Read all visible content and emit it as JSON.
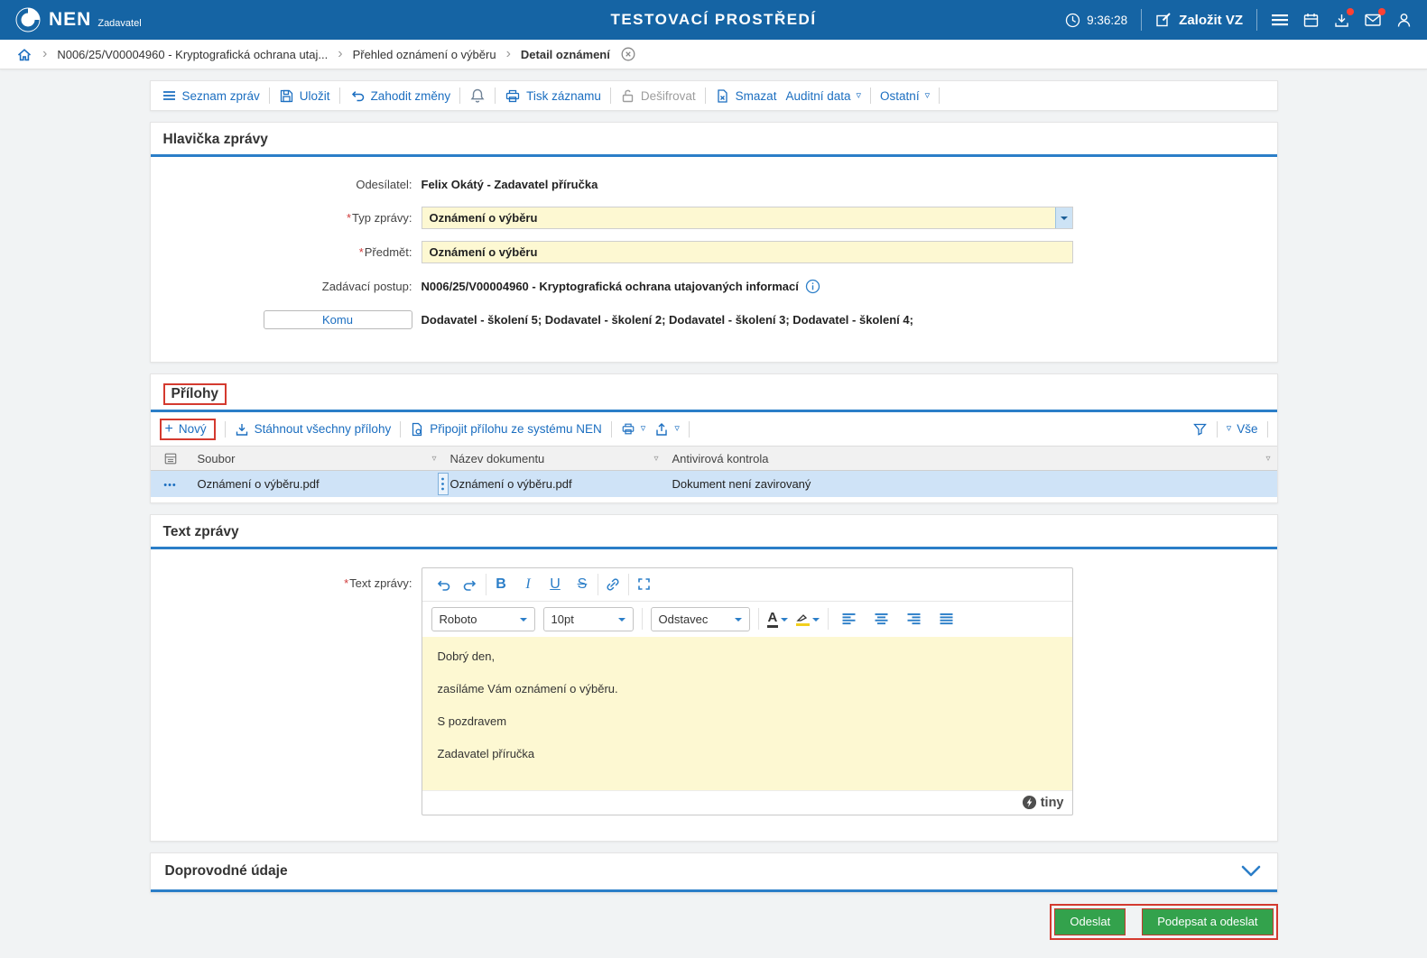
{
  "colors": {
    "topbar_blue": "#1564a4",
    "link_blue": "#1b6ec0",
    "section_line_blue": "#2b7ec8",
    "field_yellow": "#fdf8d2",
    "selected_row_blue": "#cfe3f7",
    "button_green": "#33a24c",
    "annotation_red": "#d43a2f"
  },
  "icons": {
    "dropdown": "▿",
    "crumb_sep": "›",
    "row_menu": "•••",
    "required": "*",
    "plus": "+"
  },
  "header": {
    "brand": "NEN",
    "brand_sub": "Zadavatel",
    "title": "TESTOVACÍ PROSTŘEDÍ",
    "time": "9:36:28",
    "create_button": "Založit VZ"
  },
  "breadcrumb": {
    "items": [
      "N006/25/V00004960 - Kryptografická ochrana utaj...",
      "Přehled oznámení o výběru",
      "Detail oznámení"
    ]
  },
  "actions": {
    "seznam": "Seznam zpráv",
    "ulozit": "Uložit",
    "zahodit": "Zahodit změny",
    "tisk": "Tisk záznamu",
    "desifrovat": "Dešifrovat",
    "smazat": "Smazat",
    "auditni": "Auditní data",
    "ostatni": "Ostatní"
  },
  "message": {
    "section_title": "Hlavička zprávy",
    "sender_label": "Odesílatel:",
    "sender_value": "Felix Okátý - Zadavatel příručka",
    "type_label": "Typ zprávy:",
    "type_value": "Oznámení o výběru",
    "subject_label": "Předmět:",
    "subject_value": "Oznámení o výběru",
    "procedure_label": "Zadávací postup:",
    "procedure_value": "N006/25/V00004960 - Kryptografická ochrana utajovaných informací",
    "to_button": "Komu",
    "to_value": "Dodavatel - školení 5; Dodavatel - školení 2; Dodavatel - školení 3; Dodavatel - školení 4;"
  },
  "attachments": {
    "section_title": "Přílohy",
    "new": "Nový",
    "download_all": "Stáhnout všechny přílohy",
    "attach_nen": "Připojit přílohu ze systému NEN",
    "all_filter": "Vše",
    "columns": [
      "Soubor",
      "Název dokumentu",
      "Antivirová kontrola"
    ],
    "rows": [
      {
        "file": "Oznámení o výběru.pdf",
        "doc_name": "Oznámení o výběru.pdf",
        "antivirus": "Dokument není zavirovaný"
      }
    ]
  },
  "text_message": {
    "section_title": "Text zprávy",
    "field_label": "Text zprávy:",
    "toolbar": {
      "font": "Roboto",
      "size": "10pt",
      "block": "Odstavec"
    },
    "paragraphs": [
      "Dobrý den,",
      "zasíláme Vám oznámení o výběru.",
      "S pozdravem",
      "Zadavatel příručka"
    ],
    "brand": "tiny"
  },
  "additional": {
    "section_title": "Doprovodné údaje"
  },
  "footer": {
    "send": "Odeslat",
    "sign_send": "Podepsat a odeslat"
  }
}
